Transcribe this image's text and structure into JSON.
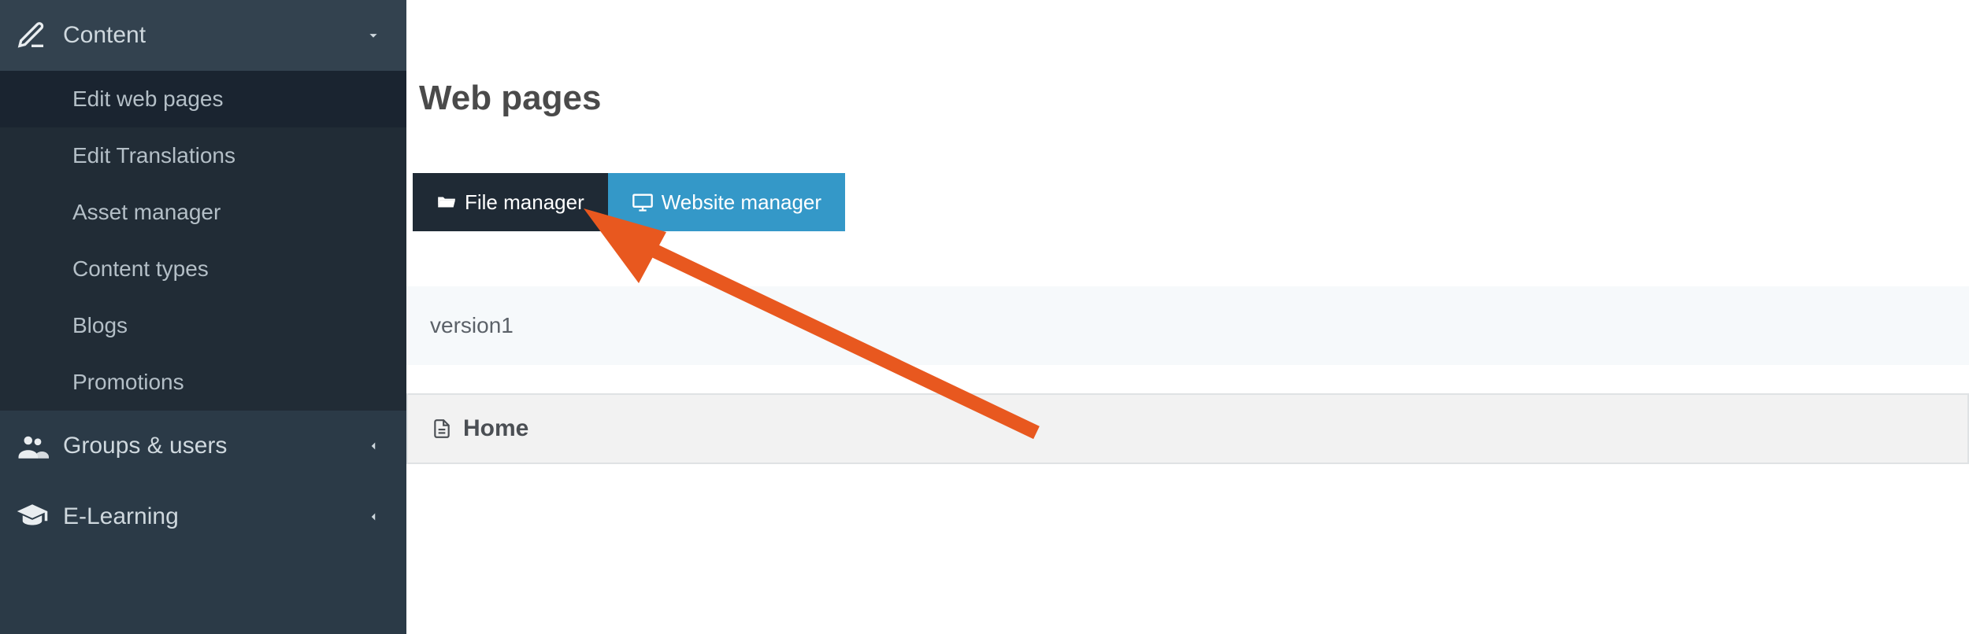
{
  "sidebar": {
    "content": {
      "label": "Content",
      "items": [
        {
          "label": "Edit web pages"
        },
        {
          "label": "Edit Translations"
        },
        {
          "label": "Asset manager"
        },
        {
          "label": "Content types"
        },
        {
          "label": "Blogs"
        },
        {
          "label": "Promotions"
        }
      ]
    },
    "groups": {
      "label": "Groups & users"
    },
    "elearning": {
      "label": "E-Learning"
    }
  },
  "main": {
    "title": "Web pages",
    "toolbar": {
      "file_manager": "File manager",
      "website_manager": "Website manager"
    },
    "version_label": "version1",
    "home_label": "Home"
  }
}
